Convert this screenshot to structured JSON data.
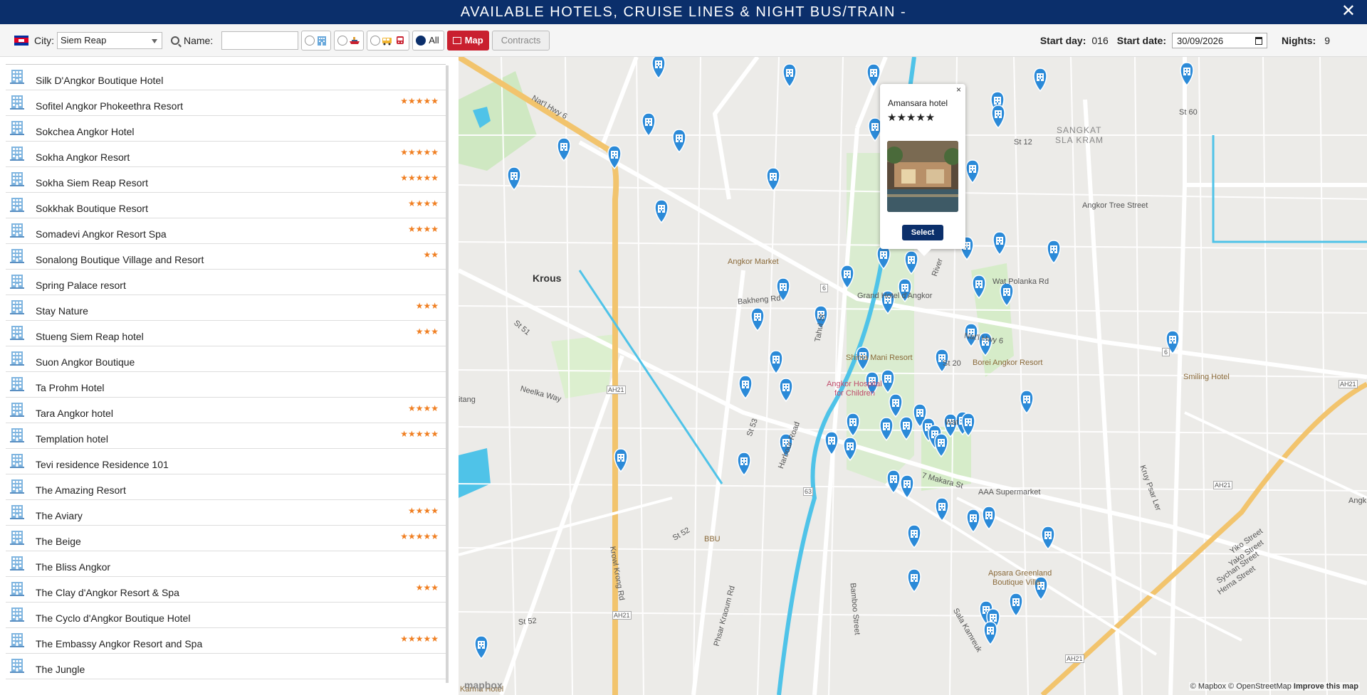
{
  "window": {
    "title": "AVAILABLE HOTELS, CRUISE LINES & NIGHT BUS/TRAIN -",
    "close_label": "✕"
  },
  "toolbar": {
    "city_label": "City:",
    "city_value": "Siem Reap",
    "name_label": "Name:",
    "name_value": "",
    "all_label": "All",
    "map_label": "Map",
    "contracts_label": "Contracts",
    "start_day_label": "Start day:",
    "start_day_value": "016",
    "start_date_label": "Start date:",
    "start_date_value": "30/09/2026",
    "nights_label": "Nights:",
    "nights_value": "9"
  },
  "hotels": [
    {
      "name": "Silk D'Angkor Boutique Hotel",
      "stars": ""
    },
    {
      "name": "Sofitel Angkor Phokeethra Resort",
      "stars": "★★★★★"
    },
    {
      "name": "Sokchea Angkor Hotel",
      "stars": ""
    },
    {
      "name": "Sokha Angkor Resort",
      "stars": "★★★★★"
    },
    {
      "name": "Sokha Siem Reap Resort",
      "stars": "★★★★★"
    },
    {
      "name": "Sokkhak Boutique Resort",
      "stars": "★★★★"
    },
    {
      "name": "Somadevi Angkor Resort Spa",
      "stars": "★★★★"
    },
    {
      "name": "Sonalong Boutique Village and Resort",
      "stars": "★★"
    },
    {
      "name": "Spring Palace resort",
      "stars": ""
    },
    {
      "name": "Stay Nature",
      "stars": "★★★"
    },
    {
      "name": "Stueng Siem Reap hotel",
      "stars": "★★★"
    },
    {
      "name": "Suon Angkor Boutique",
      "stars": ""
    },
    {
      "name": "Ta Prohm Hotel",
      "stars": ""
    },
    {
      "name": "Tara Angkor hotel",
      "stars": "★★★★"
    },
    {
      "name": "Templation hotel",
      "stars": "★★★★★"
    },
    {
      "name": "Tevi residence Residence 101",
      "stars": ""
    },
    {
      "name": "The Amazing Resort",
      "stars": ""
    },
    {
      "name": "The Aviary",
      "stars": "★★★★"
    },
    {
      "name": "The Beige",
      "stars": "★★★★★"
    },
    {
      "name": "The Bliss Angkor",
      "stars": ""
    },
    {
      "name": "The Clay d'Angkor Resort & Spa",
      "stars": "★★★"
    },
    {
      "name": "The Cyclo d'Angkor Boutique Hotel",
      "stars": ""
    },
    {
      "name": "The Embassy Angkor Resort and Spa",
      "stars": "★★★★★"
    },
    {
      "name": "The Jungle",
      "stars": ""
    }
  ],
  "popup": {
    "title": "Amansara hotel",
    "stars": "★★★★★",
    "select_label": "Select",
    "close": "×"
  },
  "map_labels": {
    "sangkat": "SANGKAT",
    "sla_kram": "SLA KRAM",
    "st60": "St 60",
    "st12": "St 12",
    "angkor_tree": "Angkor Tree Street",
    "nat_hwy_6": "Nat'l Hwy 6",
    "angkor_market": "Angkor Market",
    "krous": "Krous",
    "bakheng": "Bakheng Rd",
    "grand_hotel": "Grand Hotel d'Angkor",
    "wat_polanka": "Wat Polanka Rd",
    "river": "River",
    "st51": "St 51",
    "tahul": "Tahul St",
    "shinta_mani": "Shinta Mani Resort",
    "angkor_hospital": "Angkor Hospital",
    "for_children": "for Children",
    "borei": "Borei Angkor Resort",
    "smiling": "Smiling Hotel",
    "nat_6_b": "Nat'l Hwy 6",
    "neelka": "Neelka Way",
    "itang": "itang",
    "st53": "St 53",
    "harbour": "Harbour Road",
    "makara_st": "7 Makara St",
    "aaa": "AAA Supermarket",
    "kruy_psar": "Kruy Psar Ler",
    "st52": "St 52",
    "bbu": "BBU",
    "krowl_krong": "Krowl Krong Rd",
    "phsar_kraoum": "Phsar Kraoum Rd",
    "bamboo": "Bamboo Street",
    "sala_kanreuk": "Sala Kamreuk",
    "apsara": "Apsara Greenland",
    "boutique_villa": "Boutique Villa",
    "yiko": "Yiko Street",
    "yako": "Yako Street",
    "sychan": "Sychan Street",
    "hema": "Hema Street",
    "st52b": "St 52",
    "karma": "Karma Hotel",
    "angk": "Angk",
    "ah21a": "AH21",
    "ah21b": "AH21",
    "ah21c": "AH21",
    "ah21d": "AH21",
    "ah21e": "AH21",
    "r6": "6",
    "r6b": "6",
    "r63": "63",
    "wat": "Wat",
    "st20": "St 20"
  },
  "attribution": {
    "mapbox": "© Mapbox",
    "osm": "© OpenStreetMap",
    "improve": "Improve this map",
    "logo": "mapbox"
  },
  "colors": {
    "header": "#0b2f6b",
    "map_button": "#c9202f",
    "stars": "#f07f22",
    "pin": "#2b8ad8",
    "river": "#4fc3e8",
    "highway": "#f2c46d"
  }
}
